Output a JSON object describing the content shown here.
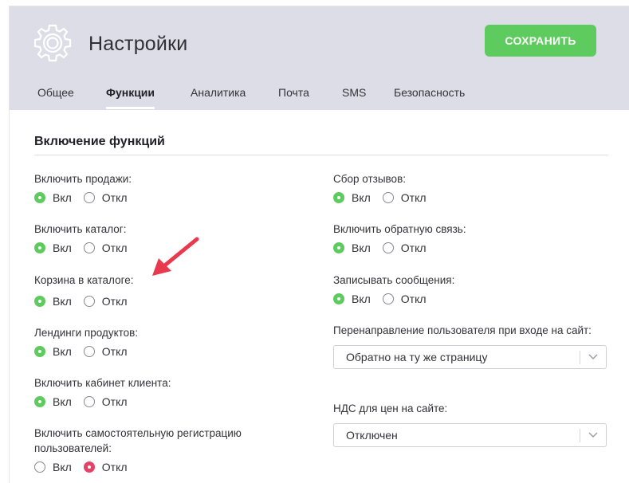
{
  "header": {
    "title": "Настройки",
    "save_label": "СОХРАНИТЬ"
  },
  "tabs": [
    {
      "label": "Общее",
      "active": false
    },
    {
      "label": "Функции",
      "active": true
    },
    {
      "label": "Аналитика",
      "active": false
    },
    {
      "label": "Почта",
      "active": false
    },
    {
      "label": "SMS",
      "active": false
    },
    {
      "label": "Безопасность",
      "active": false
    }
  ],
  "section": {
    "title": "Включение функций"
  },
  "radio_labels": {
    "on": "Вкл",
    "off": "Откл"
  },
  "left_fields": [
    {
      "label": "Включить продажи:",
      "value": "on"
    },
    {
      "label": "Включить каталог:",
      "value": "on"
    },
    {
      "label": "Корзина в каталоге:",
      "value": "on"
    },
    {
      "label": "Лендинги продуктов:",
      "value": "on"
    },
    {
      "label": "Включить кабинет клиента:",
      "value": "on"
    },
    {
      "label": "Включить самостоятельную регистрацию пользователей:",
      "value": "off"
    }
  ],
  "right_fields": [
    {
      "label": "Сбор отзывов:",
      "value": "on"
    },
    {
      "label": "Включить обратную связь:",
      "value": "on"
    },
    {
      "label": "Записывать сообщения:",
      "value": "on"
    }
  ],
  "selects": [
    {
      "label": "Перенаправление пользователя при входе на сайт:",
      "value": "Обратно на ту же страницу"
    },
    {
      "label": "НДС для цен на сайте:",
      "value": "Отключен"
    }
  ],
  "colors": {
    "accent_green": "#5ecb5e",
    "off_selected_red": "#e44266",
    "header_bg": "#dcdde6",
    "annotation_arrow": "#e8394d"
  }
}
